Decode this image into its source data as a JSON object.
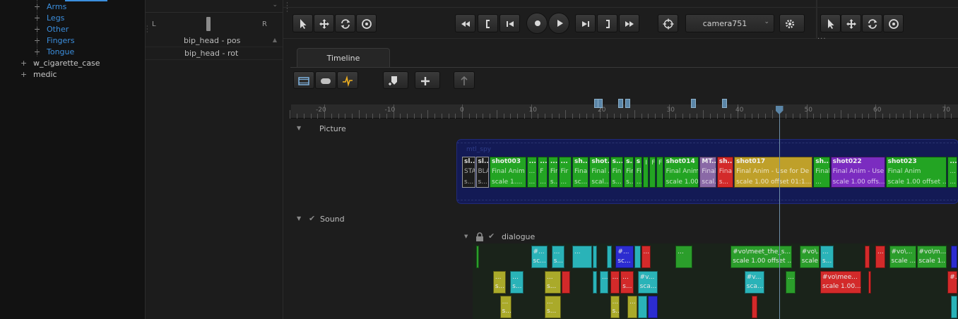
{
  "colors": {
    "accent": "#3b8edd",
    "bg": "#1d1d1d",
    "playhead": "#6f8fa8"
  },
  "tree": {
    "items": [
      {
        "label": "Arms",
        "indent": 1,
        "blue": true
      },
      {
        "label": "Legs",
        "indent": 1,
        "blue": true
      },
      {
        "label": "Other",
        "indent": 1,
        "blue": true
      },
      {
        "label": "Fingers",
        "indent": 1,
        "blue": true
      },
      {
        "label": "Tongue",
        "indent": 1,
        "blue": true
      },
      {
        "label": "w_cigarette_case",
        "indent": 0,
        "blue": false
      },
      {
        "label": "medic",
        "indent": 0,
        "blue": false
      }
    ]
  },
  "mixer": {
    "left": "L",
    "right": "R",
    "tracks": [
      "bip_head - pos",
      "bip_head - rot"
    ]
  },
  "transport": {
    "camera": "camera751"
  },
  "tab": {
    "timeline": "Timeline"
  },
  "ruler": {
    "start": -20,
    "end": 70,
    "step": 10,
    "playhead": 46,
    "markers": [
      19.5,
      20,
      23,
      24,
      33.5,
      38
    ]
  },
  "sections": {
    "picture": "Picture",
    "sound": "Sound"
  },
  "picture": {
    "group_label": "mtl_spy",
    "clips": [
      {
        "s": 0,
        "e": 2,
        "c": "#1c1c1c",
        "t": [
          "sl...",
          "STA",
          "s..."
        ]
      },
      {
        "s": 2,
        "e": 4,
        "c": "#1c1c1c",
        "t": [
          "sl...",
          "BLA",
          "s..."
        ]
      },
      {
        "s": 4,
        "e": 9.4,
        "c": "#23a423",
        "t": [
          "shot003",
          "Final Anim",
          "scale 1...."
        ]
      },
      {
        "s": 9.4,
        "e": 11,
        "c": "#23a423",
        "t": [
          "...",
          "...",
          "..."
        ]
      },
      {
        "s": 11,
        "e": 12.5,
        "c": "#23a423",
        "t": [
          "...",
          "F",
          "..."
        ]
      },
      {
        "s": 12.5,
        "e": 14,
        "c": "#23a423",
        "t": [
          "...",
          "Fir",
          "s..."
        ]
      },
      {
        "s": 14,
        "e": 16,
        "c": "#23a423",
        "t": [
          "...",
          "Fir",
          "..."
        ]
      },
      {
        "s": 16,
        "e": 18.5,
        "c": "#23a423",
        "t": [
          "sh...",
          "Final",
          "sc..."
        ]
      },
      {
        "s": 18.5,
        "e": 21.5,
        "c": "#23a423",
        "t": [
          "shot...",
          "Final A",
          "scal..."
        ]
      },
      {
        "s": 21.5,
        "e": 23.5,
        "c": "#23a423",
        "t": [
          "s...",
          "Fin",
          "s..."
        ]
      },
      {
        "s": 23.5,
        "e": 25,
        "c": "#23a423",
        "t": [
          "s...",
          "Fir",
          "s..."
        ]
      },
      {
        "s": 25,
        "e": 26.3,
        "c": "#23a423",
        "t": [
          "s",
          "Fi",
          "..."
        ]
      },
      {
        "s": 26.3,
        "e": 27.2,
        "c": "#23a423",
        "t": [
          "",
          "I",
          ""
        ]
      },
      {
        "s": 27.2,
        "e": 28.2,
        "c": "#23a423",
        "t": [
          "",
          "F",
          ""
        ]
      },
      {
        "s": 28.2,
        "e": 29.3,
        "c": "#23a423",
        "t": [
          "",
          "F",
          ""
        ]
      },
      {
        "s": 29.3,
        "e": 34.5,
        "c": "#23a423",
        "t": [
          "shot014",
          "Final Anim",
          "scale 1.00 of..."
        ]
      },
      {
        "s": 34.5,
        "e": 37,
        "c": "#8a69a6",
        "t": [
          "MT...",
          "Final",
          "scal..."
        ]
      },
      {
        "s": 37,
        "e": 39.5,
        "c": "#d32a2a",
        "t": [
          "sh...",
          "Fina",
          "s..."
        ]
      },
      {
        "s": 39.5,
        "e": 51,
        "c": "#bfa02a",
        "t": [
          "shot017",
          "Final Anim - Use for De",
          "scale 1.00 offset 01:1..."
        ]
      },
      {
        "s": 51,
        "e": 53.5,
        "c": "#23a423",
        "t": [
          "sh...",
          "Final",
          "..."
        ]
      },
      {
        "s": 53.5,
        "e": 61.5,
        "c": "#7b2cc0",
        "t": [
          "shot022",
          "Final Anim - Use",
          "scale 1.00 offs..."
        ]
      },
      {
        "s": 61.5,
        "e": 70.5,
        "c": "#23a423",
        "t": [
          "shot023",
          "Final Anim",
          "scale 1.00 offset ..."
        ]
      },
      {
        "s": 70.5,
        "e": 72,
        "c": "#23a423",
        "t": [
          "...",
          "...",
          "..."
        ]
      }
    ]
  },
  "sound": {
    "track": "dialogue",
    "clips": [
      {
        "r": 0,
        "s": 2,
        "e": 2.4,
        "c": "#2b9e2b",
        "t": [
          "",
          ""
        ]
      },
      {
        "r": 0,
        "s": 10,
        "e": 12.5,
        "c": "#2ab3b8",
        "t": [
          "#...",
          "sc..."
        ]
      },
      {
        "r": 0,
        "s": 13,
        "e": 15,
        "c": "#2ab3b8",
        "t": [
          "...",
          "s..."
        ]
      },
      {
        "r": 0,
        "s": 16,
        "e": 19,
        "c": "#2ab3b8",
        "t": [
          "...",
          ""
        ]
      },
      {
        "r": 0,
        "s": 19,
        "e": 19.7,
        "c": "#2ab3b8",
        "t": [
          "",
          ""
        ]
      },
      {
        "r": 0,
        "s": 21,
        "e": 21.8,
        "c": "#2ab3b8",
        "t": [
          "",
          ""
        ]
      },
      {
        "r": 0,
        "s": 22.3,
        "e": 25,
        "c": "#2c2cd0",
        "t": [
          "#...",
          "sc..."
        ]
      },
      {
        "r": 0,
        "s": 25,
        "e": 26,
        "c": "#2ab3b8",
        "t": [
          "",
          ""
        ]
      },
      {
        "r": 0,
        "s": 26,
        "e": 27.5,
        "c": "#d32a2a",
        "t": [
          "...",
          ""
        ]
      },
      {
        "r": 0,
        "s": 31,
        "e": 33.5,
        "c": "#2b9e2b",
        "t": [
          "...",
          ""
        ]
      },
      {
        "r": 0,
        "s": 39,
        "e": 48,
        "c": "#2b9e2b",
        "t": [
          "#vo\\meet_the_s...",
          "scale 1.00 offset ..."
        ]
      },
      {
        "r": 0,
        "s": 49,
        "e": 52,
        "c": "#2b9e2b",
        "t": [
          "#vo\\...",
          "scale ..."
        ]
      },
      {
        "r": 0,
        "s": 52,
        "e": 54,
        "c": "#2ab3b8",
        "t": [
          "...",
          "s..."
        ]
      },
      {
        "r": 0,
        "s": 58.5,
        "e": 59.3,
        "c": "#d32a2a",
        "t": [
          "",
          ""
        ]
      },
      {
        "r": 0,
        "s": 60,
        "e": 61.5,
        "c": "#d32a2a",
        "t": [
          "...",
          ""
        ]
      },
      {
        "r": 0,
        "s": 62,
        "e": 66,
        "c": "#2b9e2b",
        "t": [
          "#vo\\...",
          "scale ..."
        ]
      },
      {
        "r": 0,
        "s": 66,
        "e": 70.5,
        "c": "#2b9e2b",
        "t": [
          "#vo\\m...",
          "scale 1...."
        ]
      },
      {
        "r": 0,
        "s": 71,
        "e": 72,
        "c": "#2c2cd0",
        "t": [
          "",
          ""
        ]
      },
      {
        "r": 1,
        "s": 4.5,
        "e": 6.5,
        "c": "#aaaa2a",
        "t": [
          "...",
          "s..."
        ]
      },
      {
        "r": 1,
        "s": 7,
        "e": 9,
        "c": "#2ab3b8",
        "t": [
          "...",
          "s..."
        ]
      },
      {
        "r": 1,
        "s": 12,
        "e": 14.5,
        "c": "#aaaa2a",
        "t": [
          "...",
          "s..."
        ]
      },
      {
        "r": 1,
        "s": 14.5,
        "e": 15.8,
        "c": "#d32a2a",
        "t": [
          "",
          ""
        ]
      },
      {
        "r": 1,
        "s": 19,
        "e": 19.7,
        "c": "#2ab3b8",
        "t": [
          "",
          ""
        ]
      },
      {
        "r": 1,
        "s": 20,
        "e": 21.3,
        "c": "#2ab3b8",
        "t": [
          "...",
          ""
        ]
      },
      {
        "r": 1,
        "s": 21.5,
        "e": 23,
        "c": "#d32a2a",
        "t": [
          "...",
          ""
        ]
      },
      {
        "r": 1,
        "s": 23,
        "e": 25,
        "c": "#d32a2a",
        "t": [
          "...",
          "s..."
        ]
      },
      {
        "r": 1,
        "s": 25.5,
        "e": 28.5,
        "c": "#2ab3b8",
        "t": [
          "#v...",
          "sca..."
        ]
      },
      {
        "r": 1,
        "s": 41,
        "e": 44,
        "c": "#2ab3b8",
        "t": [
          "#v...",
          "sca..."
        ]
      },
      {
        "r": 1,
        "s": 47,
        "e": 48.5,
        "c": "#2b9e2b",
        "t": [
          "...",
          ""
        ]
      },
      {
        "r": 1,
        "s": 52,
        "e": 58,
        "c": "#d32a2a",
        "t": [
          "#vo\\mee...",
          "scale 1.00..."
        ]
      },
      {
        "r": 1,
        "s": 59,
        "e": 59.5,
        "c": "#d32a2a",
        "t": [
          "",
          ""
        ]
      },
      {
        "r": 1,
        "s": 70.5,
        "e": 72,
        "c": "#d32a2a",
        "t": [
          "#...",
          ""
        ]
      },
      {
        "r": 2,
        "s": 5.5,
        "e": 7.3,
        "c": "#aaaa2a",
        "t": [
          "...",
          "s..."
        ]
      },
      {
        "r": 2,
        "s": 12,
        "e": 14.5,
        "c": "#aaaa2a",
        "t": [
          "...",
          "s..."
        ]
      },
      {
        "r": 2,
        "s": 21.5,
        "e": 23,
        "c": "#aaaa2a",
        "t": [
          "...",
          "s..."
        ]
      },
      {
        "r": 2,
        "s": 24,
        "e": 25.5,
        "c": "#aaaa2a",
        "t": [
          "...",
          ""
        ]
      },
      {
        "r": 2,
        "s": 25.5,
        "e": 27,
        "c": "#2ab3b8",
        "t": [
          "",
          ""
        ]
      },
      {
        "r": 2,
        "s": 27,
        "e": 28.5,
        "c": "#2c2cd0",
        "t": [
          "",
          ""
        ]
      },
      {
        "r": 2,
        "s": 42,
        "e": 43,
        "c": "#d32a2a",
        "t": [
          "",
          ""
        ]
      },
      {
        "r": 2,
        "s": 71,
        "e": 72,
        "c": "#2ab3b8",
        "t": [
          "",
          ""
        ]
      }
    ]
  }
}
